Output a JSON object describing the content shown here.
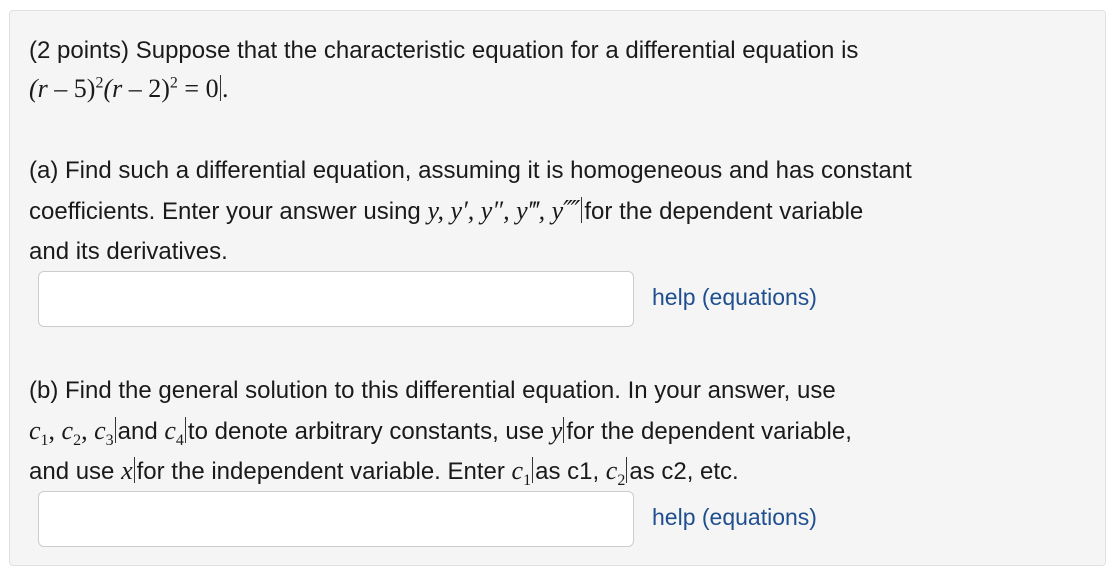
{
  "intro": {
    "text": "(2 points) Suppose that the characteristic equation for a differential equation is",
    "equation": {
      "open1": "(r",
      "minus1": " – 5)",
      "exp1": "2",
      "open2": "(r",
      "minus2": " – 2)",
      "exp2": "2",
      "equals": " = 0"
    }
  },
  "part_a": {
    "line1": "(a) Find such a differential equation, assuming it is homogeneous and has constant",
    "line2_pre": "coefficients. Enter your answer using ",
    "line2_math": "y, y′, y″, y‴, y⁗",
    "line2_post": "for the dependent variable",
    "line3": "and its derivatives.",
    "input_value": "",
    "help_label": "help (equations)"
  },
  "part_b": {
    "line1": "(b) Find the general solution to this differential equation. In your answer, use",
    "c_letter": "c",
    "sub1": "1",
    "sub2": "2",
    "sub3": "3",
    "sub4": "4",
    "comma": ", ",
    "line2_mid": "and ",
    "line2_post": "to denote arbitrary constants, use ",
    "y_var": "y",
    "line2_end": "for the dependent variable,",
    "line3_pre": "and use ",
    "x_var": "x",
    "line3_mid": "for the independent variable. Enter ",
    "as_c1": "as c1, ",
    "as_c2": "as c2, etc.",
    "input_value": "",
    "help_label": "help (equations)"
  }
}
